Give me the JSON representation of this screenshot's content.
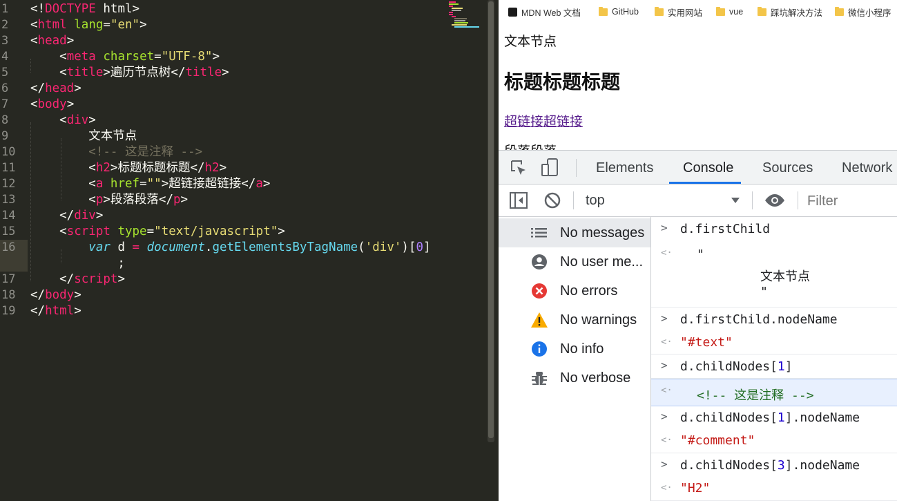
{
  "editor": {
    "line_numbers": [
      "1",
      "2",
      "3",
      "4",
      "5",
      "6",
      "7",
      "8",
      "9",
      "10",
      "11",
      "12",
      "13",
      "14",
      "15",
      "16",
      "",
      "17",
      "18",
      "19"
    ],
    "lines": {
      "l1": [
        {
          "t": "<!",
          "c": "text"
        },
        {
          "t": "DOCTYPE",
          "c": "tag"
        },
        {
          "t": " html>",
          "c": "text"
        }
      ],
      "l2": [
        {
          "t": "<",
          "c": "text"
        },
        {
          "t": "html",
          "c": "tag"
        },
        {
          "t": " ",
          "c": "text"
        },
        {
          "t": "lang",
          "c": "attr"
        },
        {
          "t": "=",
          "c": "text"
        },
        {
          "t": "\"en\"",
          "c": "str"
        },
        {
          "t": ">",
          "c": "text"
        }
      ],
      "l3": [
        {
          "t": "<",
          "c": "text"
        },
        {
          "t": "head",
          "c": "tag"
        },
        {
          "t": ">",
          "c": "text"
        }
      ],
      "l4": [
        {
          "t": "    <",
          "c": "text"
        },
        {
          "t": "meta",
          "c": "tag"
        },
        {
          "t": " ",
          "c": "text"
        },
        {
          "t": "charset",
          "c": "attr"
        },
        {
          "t": "=",
          "c": "text"
        },
        {
          "t": "\"UTF-8\"",
          "c": "str"
        },
        {
          "t": ">",
          "c": "text"
        }
      ],
      "l5": [
        {
          "t": "    <",
          "c": "text"
        },
        {
          "t": "title",
          "c": "tag"
        },
        {
          "t": ">遍历节点树</",
          "c": "text"
        },
        {
          "t": "title",
          "c": "tag"
        },
        {
          "t": ">",
          "c": "text"
        }
      ],
      "l6": [
        {
          "t": "</",
          "c": "text"
        },
        {
          "t": "head",
          "c": "tag"
        },
        {
          "t": ">",
          "c": "text"
        }
      ],
      "l7": [
        {
          "t": "<",
          "c": "text"
        },
        {
          "t": "body",
          "c": "tag"
        },
        {
          "t": ">",
          "c": "text"
        }
      ],
      "l8": [
        {
          "t": "    <",
          "c": "text"
        },
        {
          "t": "div",
          "c": "tag"
        },
        {
          "t": ">",
          "c": "text"
        }
      ],
      "l9": [
        {
          "t": "        文本节点",
          "c": "text"
        }
      ],
      "l10": [
        {
          "t": "        <!-- 这是注释 -->",
          "c": "comment"
        }
      ],
      "l11": [
        {
          "t": "        <",
          "c": "text"
        },
        {
          "t": "h2",
          "c": "tag"
        },
        {
          "t": ">标题标题标题</",
          "c": "text"
        },
        {
          "t": "h2",
          "c": "tag"
        },
        {
          "t": ">",
          "c": "text"
        }
      ],
      "l12": [
        {
          "t": "        <",
          "c": "text"
        },
        {
          "t": "a",
          "c": "tag"
        },
        {
          "t": " ",
          "c": "text"
        },
        {
          "t": "href",
          "c": "attr"
        },
        {
          "t": "=",
          "c": "text"
        },
        {
          "t": "\"\"",
          "c": "str"
        },
        {
          "t": ">超链接超链接</",
          "c": "text"
        },
        {
          "t": "a",
          "c": "tag"
        },
        {
          "t": ">",
          "c": "text"
        }
      ],
      "l13": [
        {
          "t": "        <",
          "c": "text"
        },
        {
          "t": "p",
          "c": "tag"
        },
        {
          "t": ">段落段落</",
          "c": "text"
        },
        {
          "t": "p",
          "c": "tag"
        },
        {
          "t": ">",
          "c": "text"
        }
      ],
      "l14": [
        {
          "t": "    </",
          "c": "text"
        },
        {
          "t": "div",
          "c": "tag"
        },
        {
          "t": ">",
          "c": "text"
        }
      ],
      "l15": [
        {
          "t": "    <",
          "c": "text"
        },
        {
          "t": "script",
          "c": "tag"
        },
        {
          "t": " ",
          "c": "text"
        },
        {
          "t": "type",
          "c": "attr"
        },
        {
          "t": "=",
          "c": "text"
        },
        {
          "t": "\"text/javascript\"",
          "c": "str"
        },
        {
          "t": ">",
          "c": "text"
        }
      ],
      "l16": [
        {
          "t": "        ",
          "c": "text"
        },
        {
          "t": "var",
          "c": "kw"
        },
        {
          "t": " d ",
          "c": "text"
        },
        {
          "t": "=",
          "c": "op"
        },
        {
          "t": " ",
          "c": "text"
        },
        {
          "t": "document",
          "c": "kw"
        },
        {
          "t": ".",
          "c": "text"
        },
        {
          "t": "getElementsByTagName",
          "c": "fn"
        },
        {
          "t": "(",
          "c": "text"
        },
        {
          "t": "'div'",
          "c": "str"
        },
        {
          "t": ")[",
          "c": "text"
        },
        {
          "t": "0",
          "c": "num"
        },
        {
          "t": "]",
          "c": "text"
        }
      ],
      "l16b": [
        {
          "t": "            ;",
          "c": "text"
        }
      ],
      "l17": [
        {
          "t": "    </",
          "c": "text"
        },
        {
          "t": "script",
          "c": "tag"
        },
        {
          "t": ">",
          "c": "text"
        }
      ],
      "l18": [
        {
          "t": "</",
          "c": "text"
        },
        {
          "t": "body",
          "c": "tag"
        },
        {
          "t": ">",
          "c": "text"
        }
      ],
      "l19": [
        {
          "t": "</",
          "c": "text"
        },
        {
          "t": "html",
          "c": "tag"
        },
        {
          "t": ">",
          "c": "text"
        }
      ]
    }
  },
  "bookmarks": {
    "items": [
      {
        "label": "MDN Web 文档",
        "icon": "mdn-icon"
      },
      {
        "label": "GitHub",
        "icon": "folder-icon"
      },
      {
        "label": "实用网站",
        "icon": "folder-icon"
      },
      {
        "label": "vue",
        "icon": "folder-icon"
      },
      {
        "label": "踩坑解决方法",
        "icon": "folder-icon"
      },
      {
        "label": "微信小程序",
        "icon": "folder-icon"
      }
    ]
  },
  "page": {
    "text_node": "文本节点",
    "heading": "标题标题标题",
    "link": "超链接超链接",
    "paragraph": "段落段落"
  },
  "devtools": {
    "tabs": [
      "Elements",
      "Console",
      "Sources",
      "Network"
    ],
    "active_tab": "Console",
    "context": "top",
    "filter_placeholder": "Filter",
    "sidebar": [
      {
        "label": "No messages",
        "icon": "list-icon",
        "selected": true
      },
      {
        "label": "No user me...",
        "icon": "user-icon",
        "selected": false
      },
      {
        "label": "No errors",
        "icon": "error-icon",
        "selected": false
      },
      {
        "label": "No warnings",
        "icon": "warning-icon",
        "selected": false
      },
      {
        "label": "No info",
        "icon": "info-icon",
        "selected": false
      },
      {
        "label": "No verbose",
        "icon": "bug-icon",
        "selected": false
      }
    ],
    "console": {
      "e1_in": "d.firstChild",
      "e1_out_quote1": "\"",
      "e1_out_text": "文本节点",
      "e1_out_quote2": "\"",
      "e2_in": "d.firstChild.nodeName",
      "e2_out": "\"#text\"",
      "e3_in_pre": "d.childNodes[",
      "e3_in_num": "1",
      "e3_in_post": "]",
      "e3_out": "<!-- 这是注释 -->",
      "e4_in_pre": "d.childNodes[",
      "e4_in_num": "1",
      "e4_in_post": "].nodeName",
      "e4_out": "\"#comment\"",
      "e5_in_pre": "d.childNodes[",
      "e5_in_num": "3",
      "e5_in_post": "].nodeName",
      "e5_out": "\"H2\""
    }
  }
}
